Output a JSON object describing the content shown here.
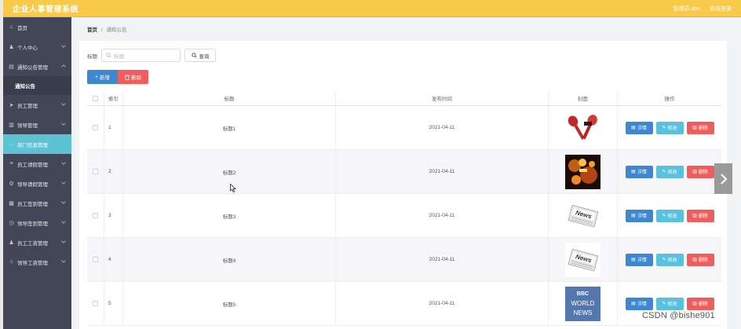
{
  "app": {
    "title": "企业人事管理系统",
    "user_label": "管理员 abo",
    "logout_label": "退出登录"
  },
  "sidebar": {
    "items": [
      {
        "label": "首页",
        "icon": "home-icon",
        "chevron": false
      },
      {
        "label": "个人中心",
        "icon": "user-icon",
        "chevron": "down"
      },
      {
        "label": "通知公告管理",
        "icon": "notice-icon",
        "chevron": "up"
      },
      {
        "label": "通知公告",
        "icon": "",
        "chevron": false,
        "sub": true
      },
      {
        "label": "员工管理",
        "icon": "send-icon",
        "chevron": "down"
      },
      {
        "label": "领导管理",
        "icon": "chart-icon",
        "chevron": "down"
      },
      {
        "label": "部门信息管理",
        "icon": "folder-icon",
        "chevron": false,
        "active": true
      },
      {
        "label": "员工请假管理",
        "icon": "bars-icon",
        "chevron": "down"
      },
      {
        "label": "领导请假管理",
        "icon": "gear-icon",
        "chevron": "down"
      },
      {
        "label": "员工签到管理",
        "icon": "grid-icon",
        "chevron": "down"
      },
      {
        "label": "领导签到管理",
        "icon": "clock-icon",
        "chevron": "down"
      },
      {
        "label": "员工工资管理",
        "icon": "user-icon",
        "chevron": "down"
      },
      {
        "label": "领导工资管理",
        "icon": "bank-icon",
        "chevron": "down"
      }
    ]
  },
  "breadcrumb": {
    "home": "首页",
    "separator": "/",
    "current": "通知公告"
  },
  "search": {
    "label": "标题",
    "placeholder": "标题",
    "button": "查询"
  },
  "toolbar": {
    "add_label": "新增",
    "delete_label": "删除"
  },
  "table": {
    "headers": {
      "index": "索引",
      "title": "标题",
      "date": "发布时间",
      "cover": "封面",
      "ops": "操作"
    },
    "rows": [
      {
        "index": "1",
        "title": "标题1",
        "date": "2021-04-11",
        "cover": "microphones"
      },
      {
        "index": "2",
        "title": "标题2",
        "date": "2021-04-11",
        "cover": "fire"
      },
      {
        "index": "3",
        "title": "标题3",
        "date": "2021-04-11",
        "cover": "news-paper"
      },
      {
        "index": "4",
        "title": "标题4",
        "date": "2021-04-11",
        "cover": "news-paper"
      },
      {
        "index": "5",
        "title": "标题5",
        "date": "2021-04-11",
        "cover": "bbc",
        "cover_text": [
          "BBC",
          "WORLD",
          "NEWS"
        ]
      }
    ],
    "op_labels": {
      "detail": "详情",
      "edit": "修改",
      "remove": "删除"
    }
  },
  "overlay": {
    "watermark": "CSDN @bishe901"
  },
  "colors": {
    "topbar": "#f9c94a",
    "sidebar": "#424657",
    "active": "#5bc3d3",
    "primary": "#3d88d0",
    "danger": "#ef5d5d",
    "info": "#5bc0de"
  }
}
